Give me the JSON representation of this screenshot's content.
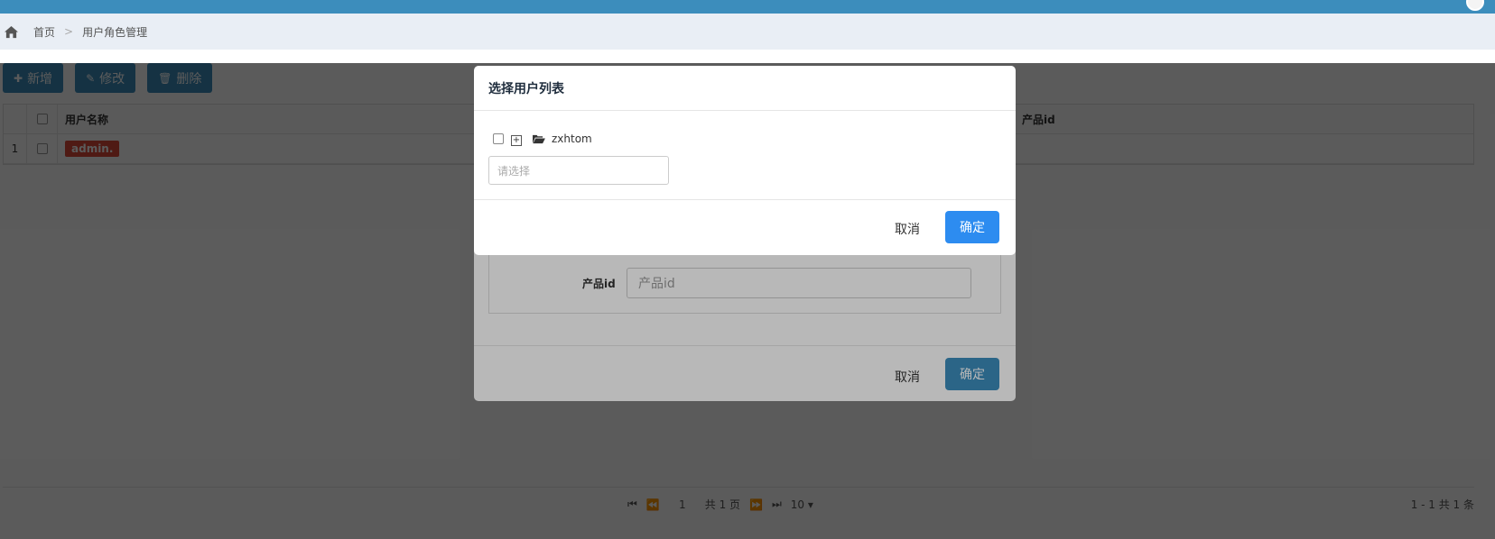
{
  "breadcrumb": {
    "home": "首页",
    "sep": ">",
    "current": "用户角色管理"
  },
  "toolbar": {
    "add": "新增",
    "edit": "修改",
    "delete": "删除"
  },
  "grid": {
    "columns": {
      "name": "用户名称",
      "product_id": "产品id"
    },
    "rows": [
      {
        "index": "1",
        "name": "admin."
      }
    ]
  },
  "pager": {
    "page": "1",
    "total_pages": "共 1 页",
    "page_size": "10 ▾",
    "info": "1 - 1 共 1 条"
  },
  "form_dialog": {
    "field_label": "产品id",
    "field_placeholder": "产品id",
    "cancel": "取消",
    "ok": "确定"
  },
  "select_dialog": {
    "title": "选择用户列表",
    "tree_node": "zxhtom",
    "select_placeholder": "请选择",
    "cancel": "取消",
    "ok": "确定"
  },
  "colors": {
    "primary": "#3c8dbc",
    "confirm": "#2d8cf0",
    "danger": "#dd4b39"
  },
  "icons": [
    "home-icon",
    "plus-icon",
    "edit-icon",
    "trash-icon",
    "folder-open-icon",
    "tree-expand-icon"
  ]
}
